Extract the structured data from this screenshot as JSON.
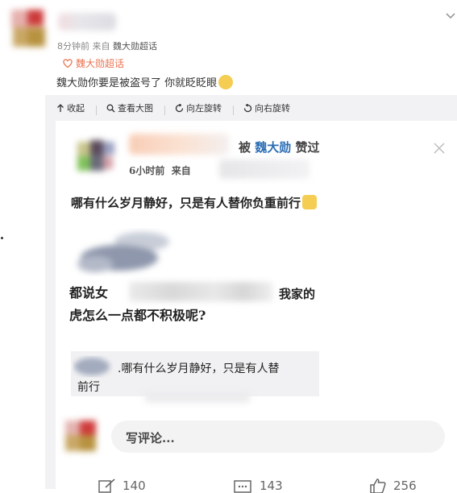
{
  "post": {
    "meta": "8分钟前 来自",
    "meta_link": "魏大勋超话",
    "topic": "魏大勋超话",
    "text": "魏大勋你要是被盗号了 你就眨眨眼"
  },
  "toolbar": {
    "collapse": "收起",
    "view_large": "查看大图",
    "rotate_left": "向左旋转",
    "rotate_right": "向右旋转"
  },
  "card": {
    "liked_prefix": "被",
    "liked_name": "魏大勋",
    "liked_suffix": "赞过",
    "time": "6小时前",
    "from": "来自",
    "text": "哪有什么岁月静好，只是有人替你负重前行",
    "question_start": "都说女",
    "question_mid": "我家的",
    "question_line2": "虎怎么一点都不积极呢?",
    "quote_line1": ".哪有什么岁月静好，只是有人替",
    "quote_line2": "前行",
    "comment_placeholder": "写评论..."
  },
  "footer": {
    "reposts": "140",
    "comments": "143",
    "likes": "256"
  },
  "colors": {
    "accent": "#eb7350",
    "link": "#2b6db4",
    "panel": "#f2f2f5"
  }
}
